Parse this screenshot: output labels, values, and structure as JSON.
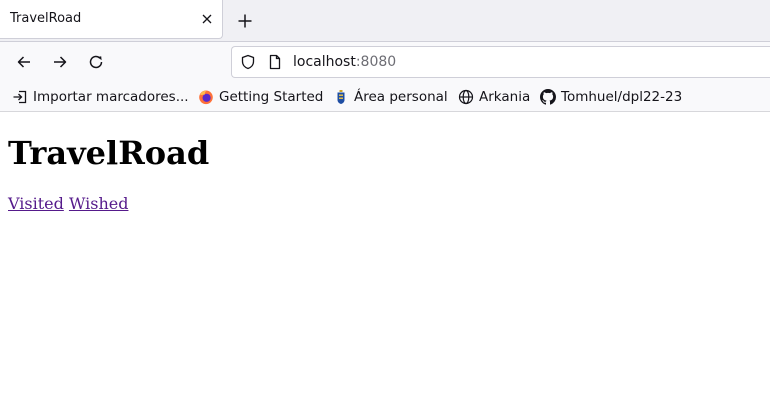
{
  "browser": {
    "tab": {
      "title": "TravelRoad",
      "close_icon": "close-icon"
    },
    "new_tab_icon": "plus-icon",
    "nav": {
      "back_icon": "arrow-left-icon",
      "forward_icon": "arrow-right-icon",
      "reload_icon": "reload-icon"
    },
    "url": {
      "host": "localhost",
      "port": ":8080",
      "shield_icon": "shield-icon",
      "page_icon": "page-icon"
    },
    "bookmarks": [
      {
        "label": "Importar marcadores...",
        "icon": "import-icon"
      },
      {
        "label": "Getting Started",
        "icon": "firefox-icon"
      },
      {
        "label": "Área personal",
        "icon": "canarias-crest-icon"
      },
      {
        "label": "Arkania",
        "icon": "globe-icon"
      },
      {
        "label": "Tomhuel/dpl22-23",
        "icon": "github-icon"
      }
    ]
  },
  "page": {
    "title": "TravelRoad",
    "links": [
      {
        "label": "Visited"
      },
      {
        "label": "Wished"
      }
    ]
  },
  "colors": {
    "link_visited": "#551a8b",
    "tabstrip_bg": "#f0f0f4",
    "toolbar_bg": "#f9f9fb"
  }
}
